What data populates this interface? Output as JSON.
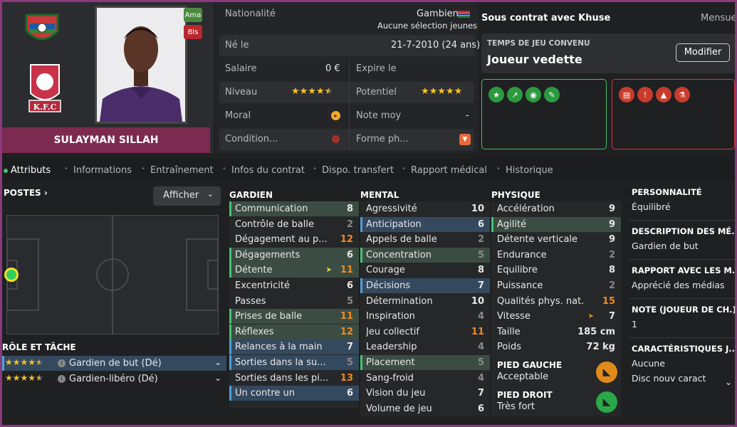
{
  "player": {
    "name": "SULAYMAN SILLAH",
    "badge_ama": "Ama",
    "badge_bls": "Bls"
  },
  "club_logo_text": "K.F.C",
  "info": {
    "nationality_label": "Nationalité",
    "nationality_value": "Gambien",
    "nationality_sub": "Aucune sélection jeunes",
    "born_label": "Né le",
    "born_value": "21-7-2010 (24 ans)",
    "salary_label": "Salaire",
    "salary_value": "0 €",
    "expires_label": "Expire le",
    "level_label": "Niveau",
    "level_stars": 4.5,
    "potential_label": "Potentiel",
    "potential_stars": 5,
    "morale_label": "Moral",
    "avg_label": "Note moy",
    "avg_value": "-",
    "condition_label": "Condition...",
    "form_label": "Forme ph..."
  },
  "contract": {
    "title": "Sous contrat avec Khuse",
    "freq": "Mensuel",
    "playtime_label": "TEMPS DE JEU CONVENU",
    "playtime_value": "Joueur vedette",
    "modify_button": "Modifier"
  },
  "tabs": [
    "Attributs",
    "Informations",
    "Entraînement",
    "Infos du contrat",
    "Dispo. transfert",
    "Rapport médical",
    "Historique"
  ],
  "positions": {
    "title": "POSTES ›",
    "show_button": "Afficher"
  },
  "roles": {
    "title": "RÔLE ET TÂCHE",
    "items": [
      {
        "label": "Gardien de but (Dé)"
      },
      {
        "label": "Gardien-libéro (Dé)"
      }
    ]
  },
  "goalkeeping": {
    "title": "GARDIEN",
    "rows": [
      {
        "name": "Communication",
        "value": "8"
      },
      {
        "name": "Contrôle de balle",
        "value": "2"
      },
      {
        "name": "Dégagement au p...",
        "value": "12"
      },
      {
        "name": "Dégagements",
        "value": "6"
      },
      {
        "name": "Détente",
        "value": "11"
      },
      {
        "name": "Excentricité",
        "value": "6"
      },
      {
        "name": "Passes",
        "value": "5"
      },
      {
        "name": "Prises de balle",
        "value": "11"
      },
      {
        "name": "Réflexes",
        "value": "12"
      },
      {
        "name": "Relances à la main",
        "value": "7"
      },
      {
        "name": "Sorties dans la su...",
        "value": "5"
      },
      {
        "name": "Sorties dans les pi...",
        "value": "13"
      },
      {
        "name": "Un contre un",
        "value": "6"
      }
    ]
  },
  "mental": {
    "title": "MENTAL",
    "rows": [
      {
        "name": "Agressivité",
        "value": "10"
      },
      {
        "name": "Anticipation",
        "value": "6"
      },
      {
        "name": "Appels de balle",
        "value": "2"
      },
      {
        "name": "Concentration",
        "value": "5"
      },
      {
        "name": "Courage",
        "value": "8"
      },
      {
        "name": "Décisions",
        "value": "7"
      },
      {
        "name": "Détermination",
        "value": "10"
      },
      {
        "name": "Inspiration",
        "value": "4"
      },
      {
        "name": "Jeu collectif",
        "value": "11"
      },
      {
        "name": "Leadership",
        "value": "4"
      },
      {
        "name": "Placement",
        "value": "5"
      },
      {
        "name": "Sang-froid",
        "value": "4"
      },
      {
        "name": "Vision du jeu",
        "value": "7"
      },
      {
        "name": "Volume de jeu",
        "value": "6"
      }
    ]
  },
  "physical": {
    "title": "PHYSIQUE",
    "rows": [
      {
        "name": "Accélération",
        "value": "9"
      },
      {
        "name": "Agilité",
        "value": "9"
      },
      {
        "name": "Détente verticale",
        "value": "9"
      },
      {
        "name": "Endurance",
        "value": "2"
      },
      {
        "name": "Équilibre",
        "value": "8"
      },
      {
        "name": "Puissance",
        "value": "2"
      },
      {
        "name": "Qualités phys. nat.",
        "value": "15"
      },
      {
        "name": "Vitesse",
        "value": "7"
      },
      {
        "name": "Taille",
        "value": "185 cm"
      },
      {
        "name": "Poids",
        "value": "72 kg"
      }
    ]
  },
  "feet": {
    "left_label": "PIED GAUCHE",
    "left_value": "Acceptable",
    "right_label": "PIED DROIT",
    "right_value": "Très fort"
  },
  "right_panel": [
    {
      "title": "PERSONNALITÉ",
      "text": "Équilibré"
    },
    {
      "title": "DESCRIPTION DES MÉ...",
      "text": "Gardien de but"
    },
    {
      "title": "RAPPORT AVEC LES M...",
      "text": "Apprécié des médias"
    },
    {
      "title": "NOTE (JOUEUR DE CH.)",
      "text": "1"
    },
    {
      "title": "CARACTÉRISTIQUES J...",
      "text": "Aucune",
      "text2": "Disc nouv caract"
    }
  ],
  "colors": {
    "accent_green": "#46c46e",
    "accent_red": "#d23a3a",
    "orange": "#f28b1e",
    "star": "#f3c229"
  }
}
